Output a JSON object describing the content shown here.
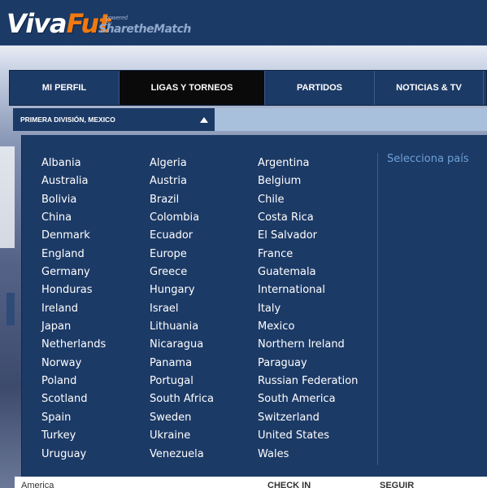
{
  "header": {
    "logo_viva": "Viva",
    "logo_fut": "Fut",
    "logo_powered": "powered by",
    "logo_share": "SharetheMatch"
  },
  "nav": {
    "tabs": [
      {
        "label": "MI PERFIL",
        "active": false
      },
      {
        "label": "LIGAS Y TORNEOS",
        "active": true
      },
      {
        "label": "PARTIDOS",
        "active": false
      },
      {
        "label": "NOTICIAS & TV",
        "active": false
      }
    ]
  },
  "league_selector": {
    "label": "PRIMERA DIVISIÓN, MEXICO",
    "icon": "caret-up-icon"
  },
  "countries": {
    "col1": [
      "Albania",
      "Australia",
      "Bolivia",
      "China",
      "Denmark",
      "England",
      "Germany",
      "Honduras",
      "Ireland",
      "Japan",
      "Netherlands",
      "Norway",
      "Poland",
      "Scotland",
      "Spain",
      "Turkey",
      "Uruguay"
    ],
    "col2": [
      "Algeria",
      "Austria",
      "Brazil",
      "Colombia",
      "Ecuador",
      "Europe",
      "Greece",
      "Hungary",
      "Israel",
      "Lithuania",
      "Nicaragua",
      "Panama",
      "Portugal",
      "South Africa",
      "Sweden",
      "Ukraine",
      "Venezuela"
    ],
    "col3": [
      "Argentina",
      "Belgium",
      "Chile",
      "Costa Rica",
      "El Salvador",
      "France",
      "Guatemala",
      "International",
      "Italy",
      "Mexico",
      "Northern Ireland",
      "Paraguay",
      "Russian Federation",
      "South America",
      "Switzerland",
      "United States",
      "Wales"
    ]
  },
  "select_country_label": "Selecciona país",
  "bottom": {
    "left": "America",
    "mid": "CHECK IN",
    "right": "SEGUIR"
  },
  "colors": {
    "navy": "#1c3a66",
    "accent_orange": "#f07a10",
    "link_blue": "#6fa0d8",
    "active_tab": "#0a0a0a"
  }
}
